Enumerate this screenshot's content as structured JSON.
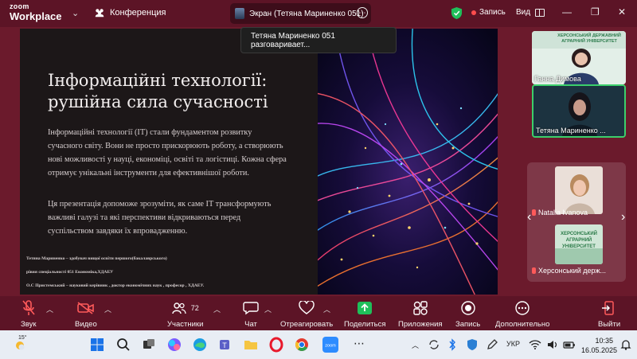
{
  "app": {
    "logo_line1": "zoom",
    "logo_line2": "Workplace",
    "meeting_label": "Конференция",
    "screen_share_label": "Экран (Тетяна Мариненко 051)",
    "record_label": "Запись",
    "view_label": "Вид"
  },
  "tooltip": "Тетяна Мариненко 051 разговаривает...",
  "slide": {
    "title_line1": "Інформаційні технології:",
    "title_line2": "рушійна сила сучасності",
    "para1": [
      "Інформаційні технології (IT) стали фундаментом розвитку",
      "сучасного світу. Вони не просто прискорюють роботу, а створюють",
      "нові можливості у науці, економіці, освіті та логістиці. Кожна сфера",
      "отримує унікальні інструменти для ефективнішої роботи."
    ],
    "para2": [
      "Ця презентація допоможе зрозуміти, як саме IT трансформують",
      "важливі галузі та які перспективи відкриваються перед",
      "суспільством завдяки їх впровадженню."
    ],
    "footer": [
      "Тетяна Мариненко – здобувач вищої освіти першого(бакалаврського)",
      "рівня спеціальності 051 Економіка,ХДАЕУ",
      "О.С Пристемський – науковий керівник , доктор економічних наук , професор , ХДАЕУ."
    ]
  },
  "participants": {
    "tile1_name": "Ганна Димова",
    "tile2_name": "Тетяна Мариненко ...",
    "gallery1_name": "Natalia Ivanova",
    "gallery2_name": "Херсонський держ...",
    "tile1_banner": "ХЕРСОНСЬКИЙ ДЕРЖАВНИЙ АГРАРНИЙ УНІВЕРСИТЕТ",
    "gallery2_banner": "ХЕРСОНСЬКИЙ АГРАРНИЙ УНІВЕРСИТЕТ"
  },
  "toolbar": {
    "audio": "Звук",
    "video": "Видео",
    "participants": "Участники",
    "participants_count": "72",
    "chat": "Чат",
    "react": "Отреагировать",
    "share": "Поделиться",
    "apps": "Приложения",
    "record": "Запись",
    "more": "Дополнительно",
    "leave": "Выйти"
  },
  "taskbar": {
    "temperature": "15°",
    "language": "УКР",
    "time": "10:35",
    "date": "16.05.2025"
  },
  "colors": {
    "accent_bg": "#6b1a2c",
    "bar_bg": "#5c1426",
    "share_green": "#1fbf5a",
    "active_speaker": "#3ccf6b"
  }
}
